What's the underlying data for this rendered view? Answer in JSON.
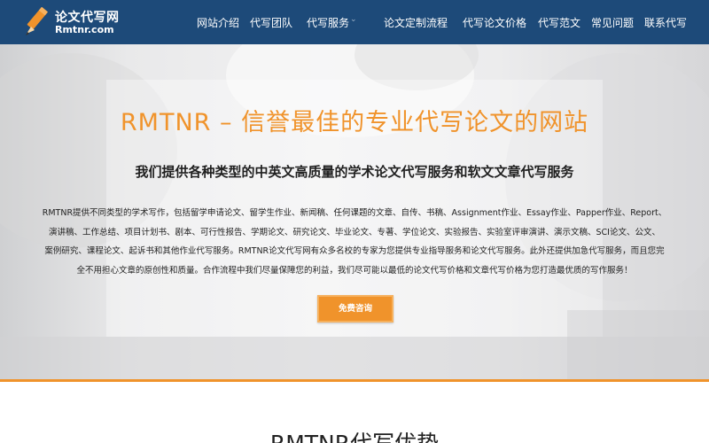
{
  "logo": {
    "title": "论文代写网",
    "subtitle": "Rmtnr.com",
    "icon": "pencil-icon"
  },
  "nav": {
    "items": [
      {
        "label": "网站介绍"
      },
      {
        "label": "代写团队"
      },
      {
        "label": "代写服务"
      },
      {
        "label": "论文定制流程"
      },
      {
        "label": "代写论文价格"
      },
      {
        "label": "代写范文"
      },
      {
        "label": "常见问题"
      },
      {
        "label": "联系代写"
      }
    ],
    "caret": "⌄"
  },
  "hero": {
    "title": "RMTNR – 信誉最佳的专业代写论文的网站",
    "subtitle": "我们提供各种类型的中英文高质量的学术论文代写服务和软文文章代写服务",
    "lines": [
      "RMTNR提供不同类型的学术写作，包括留学申请论文、留学生作业、新闻稿、任何课题的文章、自传、书稿、Assignment作业、Essay作业、Papper作业、Report、",
      "演讲稿、工作总结、项目计划书、剧本、可行性报告、学期论文、研究论文、毕业论文、专著、学位论文、实验报告、实验室评审演讲、演示文稿、SCI论文、公文、",
      "案例研究、课程论文、起诉书和其他作业代写服务。RMTNR论文代写网有众多名校的专家为您提供专业指导服务和论文代写服务。此外还提供加急代写服务，而且您完",
      "全不用担心文章的原创性和质量。合作流程中我们尽量保障您的利益，我们尽可能以最低的论文代写价格和文章代写价格为您打造最优质的写作服务！"
    ],
    "button_label": "免费咨询"
  },
  "section": {
    "title": "RMTNR代写优势"
  },
  "colors": {
    "header_bg": "#1d4a79",
    "accent": "#f0932b",
    "text": "#222222"
  }
}
